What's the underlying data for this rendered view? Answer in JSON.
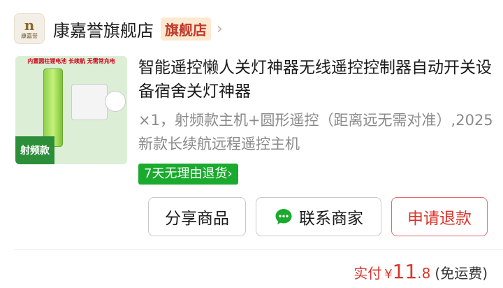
{
  "store": {
    "logo_mark": "n",
    "logo_text": "康嘉誉",
    "name": "康嘉誉旗舰店",
    "badge": "旗舰店",
    "chevron": "›"
  },
  "product": {
    "image": {
      "banner_text": "内置圆柱锂电池 长续航 无需常充电",
      "tag_text": "射频款"
    },
    "title": "智能遥控懒人关灯神器无线遥控控制器自动开关设备宿舍关灯神器",
    "spec": "×1，射频款主机+圆形遥控（距离远无需对准）,2025新款长续航远程遥控主机",
    "return_badge": "7天无理由退货›"
  },
  "actions": {
    "share": "分享商品",
    "contact": "联系商家",
    "refund": "申请退款"
  },
  "price": {
    "label": "实付",
    "currency": "¥",
    "integer": "11",
    "decimal": ".8",
    "shipping": "(免运费)"
  },
  "colors": {
    "accent_red": "#d8362b",
    "return_green": "#1aaa2e",
    "chat_green": "#1aaa2e"
  },
  "icons": {
    "chat": "chat-bubble-icon",
    "chevron": "chevron-right-icon"
  }
}
